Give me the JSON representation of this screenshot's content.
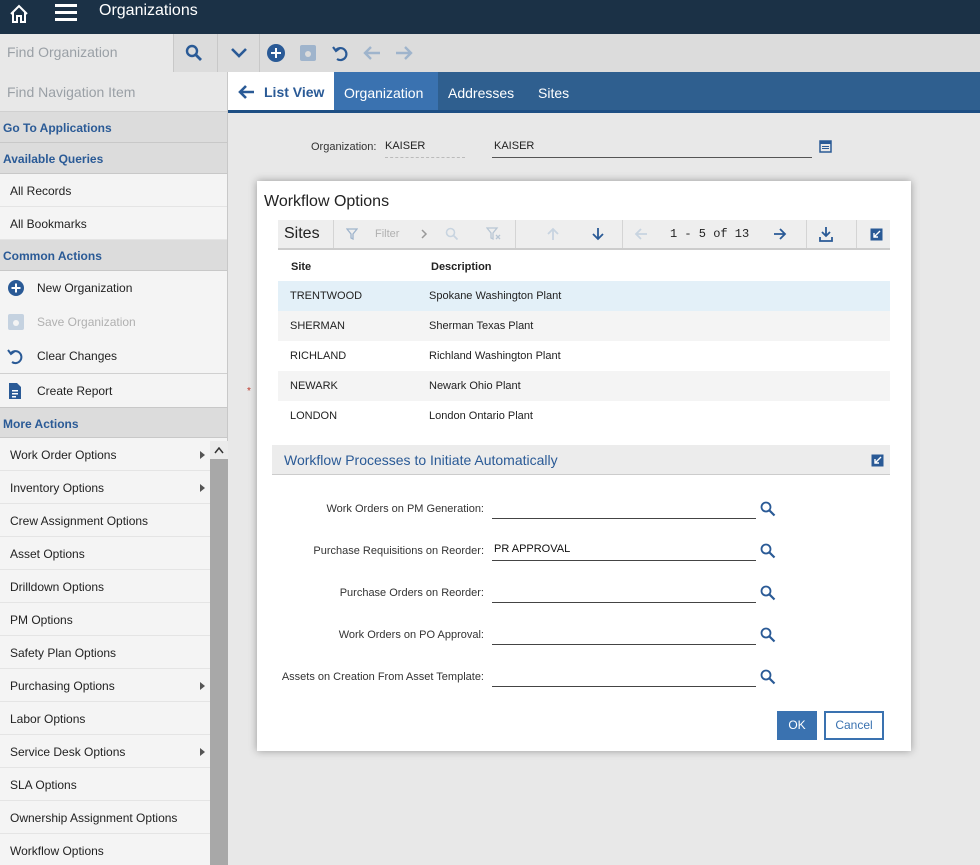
{
  "header": {
    "title": "Organizations",
    "home_icon": "home-icon",
    "menu_icon": "hamburger-menu-icon"
  },
  "toolbar": {
    "find_placeholder": "Find Organization",
    "icons": [
      "search-icon",
      "chevron-down-icon",
      "add-icon",
      "save-icon",
      "undo-icon",
      "arrow-left-icon",
      "arrow-right-icon"
    ]
  },
  "sidebar": {
    "search_placeholder": "Find Navigation Item",
    "go_to_applications": "Go To Applications",
    "available_queries": "Available Queries",
    "queries": [
      "All Records",
      "All Bookmarks"
    ],
    "common_actions": "Common Actions",
    "actions": [
      {
        "label": "New Organization",
        "icon": "add-icon",
        "enabled": true
      },
      {
        "label": "Save Organization",
        "icon": "save-icon",
        "enabled": false
      },
      {
        "label": "Clear Changes",
        "icon": "undo-icon",
        "enabled": true
      },
      {
        "label": "Create Report",
        "icon": "report-icon",
        "enabled": true
      }
    ],
    "more_actions": "More Actions",
    "more_items": [
      {
        "label": "Work Order Options",
        "submenu": true
      },
      {
        "label": "Inventory Options",
        "submenu": true
      },
      {
        "label": "Crew Assignment Options",
        "submenu": false
      },
      {
        "label": "Asset Options",
        "submenu": false
      },
      {
        "label": "Drilldown Options",
        "submenu": false
      },
      {
        "label": "PM Options",
        "submenu": false
      },
      {
        "label": "Safety Plan Options",
        "submenu": false
      },
      {
        "label": "Purchasing Options",
        "submenu": true
      },
      {
        "label": "Labor Options",
        "submenu": false
      },
      {
        "label": "Service Desk Options",
        "submenu": true
      },
      {
        "label": "SLA Options",
        "submenu": false
      },
      {
        "label": "Ownership Assignment Options",
        "submenu": false
      },
      {
        "label": "Workflow Options",
        "submenu": false
      }
    ]
  },
  "tabs": {
    "list_view": "List View",
    "organization": "Organization",
    "addresses": "Addresses",
    "sites": "Sites",
    "active": "Organization"
  },
  "org_form": {
    "label": "Organization:",
    "value": "KAISER",
    "description": "KAISER"
  },
  "dialog": {
    "title": "Workflow Options",
    "sites": {
      "label": "Sites",
      "filter_label": "Filter",
      "pagination": "1 - 5 of 13",
      "columns": {
        "site": "Site",
        "description": "Description"
      },
      "rows": [
        {
          "site": "TRENTWOOD",
          "description": "Spokane Washington Plant",
          "selected": true
        },
        {
          "site": "SHERMAN",
          "description": "Sherman Texas Plant",
          "selected": false
        },
        {
          "site": "RICHLAND",
          "description": "Richland Washington Plant",
          "selected": false
        },
        {
          "site": "NEWARK",
          "description": "Newark Ohio Plant",
          "selected": false
        },
        {
          "site": "LONDON",
          "description": "London Ontario Plant",
          "selected": false
        }
      ]
    },
    "workflow_section": {
      "title": "Workflow Processes to Initiate Automatically",
      "fields": [
        {
          "label": "Work Orders on PM Generation:",
          "value": ""
        },
        {
          "label": "Purchase Requisitions on Reorder:",
          "value": "PR APPROVAL"
        },
        {
          "label": "Purchase Orders on Reorder:",
          "value": ""
        },
        {
          "label": "Work Orders on PO Approval:",
          "value": ""
        },
        {
          "label": "Assets on Creation From Asset Template:",
          "value": ""
        }
      ]
    },
    "ok_label": "OK",
    "cancel_label": "Cancel"
  },
  "colors": {
    "header_bg": "#1b3146",
    "tab_bg": "#2f5f8f",
    "accent": "#3a72b0",
    "selected_row": "#e3f0f8",
    "link": "#2a5a96"
  }
}
